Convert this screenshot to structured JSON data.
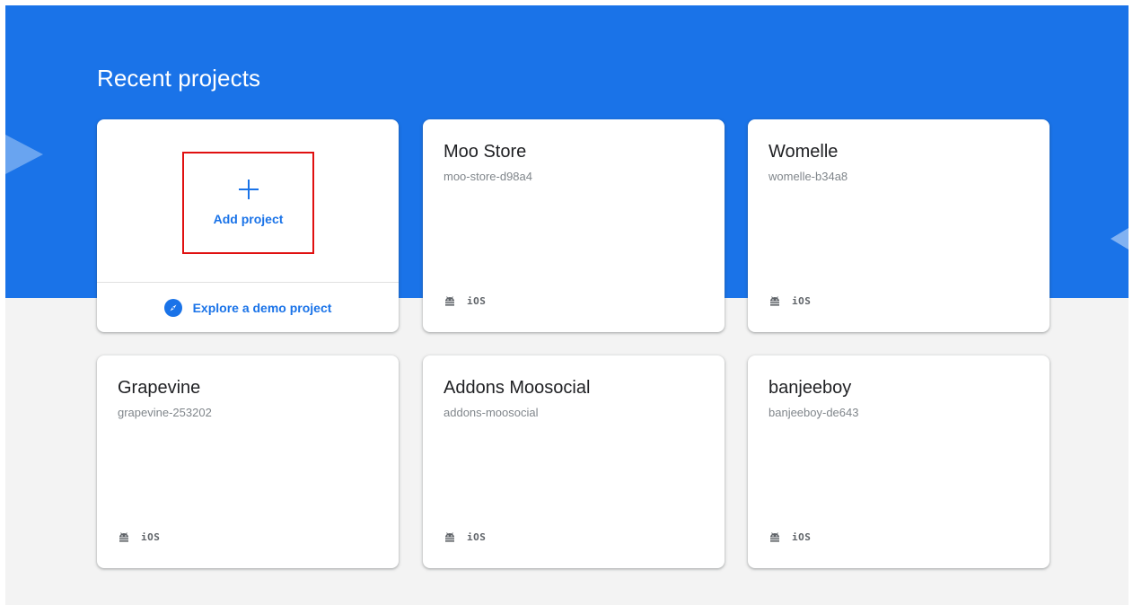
{
  "header": {
    "title": "Recent projects"
  },
  "add_card": {
    "add_label": "Add project",
    "demo_label": "Explore a demo project"
  },
  "projects": [
    {
      "name": "Moo Store",
      "id": "moo-store-d98a4",
      "platform": "iOS"
    },
    {
      "name": "Womelle",
      "id": "womelle-b34a8",
      "platform": "iOS"
    },
    {
      "name": "Grapevine",
      "id": "grapevine-253202",
      "platform": "iOS"
    },
    {
      "name": "Addons Moosocial",
      "id": "addons-moosocial",
      "platform": "iOS"
    },
    {
      "name": "banjeeboy",
      "id": "banjeeboy-de643",
      "platform": "iOS"
    }
  ],
  "colors": {
    "accent": "#1a73e8",
    "highlight": "#e01010",
    "background": "#f3f3f3"
  },
  "icons": [
    "plus-icon",
    "compass-icon",
    "android-icon"
  ]
}
